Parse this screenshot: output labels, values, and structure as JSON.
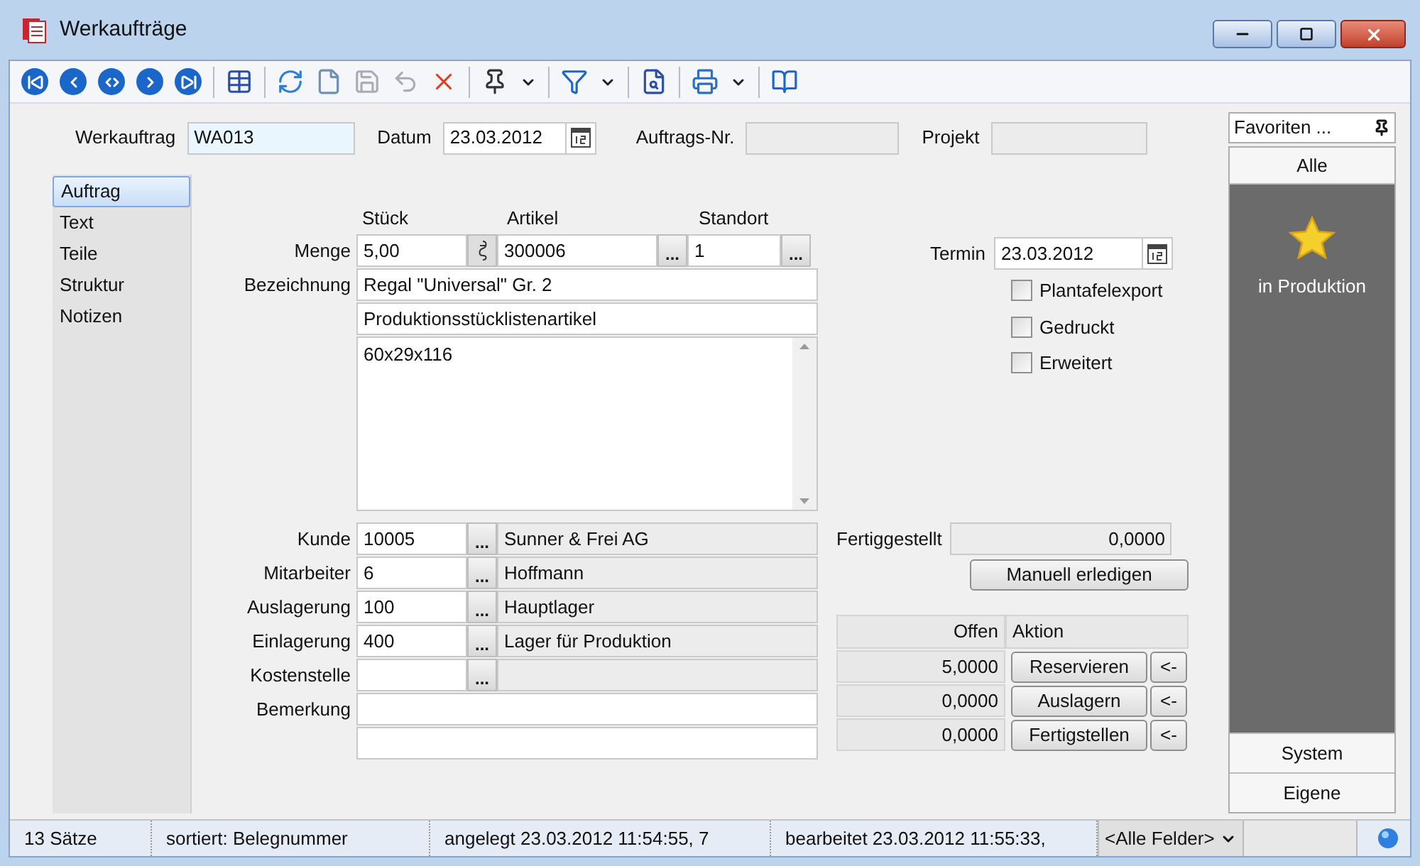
{
  "window": {
    "title": "Werkaufträge"
  },
  "toolbar": [
    {
      "kind": "first",
      "disabled": false
    },
    {
      "kind": "prev",
      "disabled": false
    },
    {
      "kind": "goto",
      "disabled": false
    },
    {
      "kind": "next",
      "disabled": false
    },
    {
      "kind": "last",
      "disabled": false
    },
    {
      "kind": "sep"
    },
    {
      "kind": "table",
      "disabled": false
    },
    {
      "kind": "sep"
    },
    {
      "kind": "refresh",
      "disabled": false
    },
    {
      "kind": "new",
      "disabled": false
    },
    {
      "kind": "save",
      "disabled": true
    },
    {
      "kind": "undo",
      "disabled": true
    },
    {
      "kind": "delete",
      "disabled": false
    },
    {
      "kind": "sep"
    },
    {
      "kind": "pin",
      "disabled": false
    },
    {
      "kind": "caret",
      "disabled": false
    },
    {
      "kind": "sep"
    },
    {
      "kind": "filter",
      "disabled": false
    },
    {
      "kind": "caret",
      "disabled": false
    },
    {
      "kind": "sep"
    },
    {
      "kind": "doc",
      "disabled": false
    },
    {
      "kind": "sep"
    },
    {
      "kind": "print",
      "disabled": false
    },
    {
      "kind": "caret",
      "disabled": false
    },
    {
      "kind": "sep"
    },
    {
      "kind": "book",
      "disabled": false
    }
  ],
  "header": {
    "werkauftrag": {
      "label": "Werkauftrag",
      "value": "WA013"
    },
    "datum": {
      "label": "Datum",
      "value": "23.03.2012"
    },
    "auftrags_nr": {
      "label": "Auftrags-Nr."
    },
    "projekt": {
      "label": "Projekt"
    }
  },
  "nav": [
    {
      "label": "Auftrag",
      "selected": true
    },
    {
      "label": "Text",
      "selected": false
    },
    {
      "label": "Teile",
      "selected": false
    },
    {
      "label": "Struktur",
      "selected": false
    },
    {
      "label": "Notizen",
      "selected": false
    }
  ],
  "form": {
    "column_heads": [
      "Stück",
      "Artikel",
      "Standort"
    ],
    "menge": {
      "label": "Menge",
      "stueck": "5,00",
      "artikel": "300006",
      "artikel_button": "...",
      "standort": "1",
      "standort_button": "..."
    },
    "bezeichnung": {
      "label": "Bezeichnung",
      "line_1": "Regal \"Universal\" Gr. 2",
      "line_2": "Produktionsstücklistenartikel",
      "memo": "60x29x116"
    },
    "lookups": [
      {
        "label": "Kunde",
        "code": "10005",
        "button": "...",
        "name": "Sunner & Frei AG"
      },
      {
        "label": "Mitarbeiter",
        "code": "6",
        "button": "...",
        "name": "Hoffmann"
      },
      {
        "label": "Auslagerung",
        "code": "100",
        "button": "...",
        "name": "Hauptlager"
      },
      {
        "label": "Einlagerung",
        "code": "400",
        "button": "...",
        "name": "Lager für Produktion"
      },
      {
        "label": "Kostenstelle",
        "button": "..."
      }
    ],
    "bemerkung": {
      "label": "Bemerkung"
    }
  },
  "side": {
    "termin": {
      "label": "Termin",
      "value": "23.03.2012"
    },
    "checkboxes": [
      {
        "label": "Plantafelexport",
        "checked": false
      },
      {
        "label": "Gedruckt",
        "checked": false
      },
      {
        "label": "Erweitert",
        "checked": false
      }
    ],
    "fertiggestellt": {
      "label": "Fertiggestellt",
      "value": "0,0000"
    },
    "manual_button": "Manuell erledigen",
    "actions": {
      "columns": [
        "Offen",
        "Aktion"
      ],
      "rows": [
        {
          "offen": "5,0000",
          "action": "Reservieren",
          "arrow": "<-"
        },
        {
          "offen": "0,0000",
          "action": "Auslagern",
          "arrow": "<-"
        },
        {
          "offen": "0,0000",
          "action": "Fertigstellen",
          "arrow": "<-"
        }
      ]
    }
  },
  "favorites": {
    "title": "Favoriten ...",
    "top_tab": "Alle",
    "items": [
      "in Produktion"
    ],
    "bottom_tabs": [
      "System",
      "Eigene"
    ]
  },
  "status_bar": {
    "segments": [
      "13 Sätze",
      "sortiert: Belegnummer",
      "angelegt 23.03.2012 11:54:55,  7",
      "bearbeitet 23.03.2012 11:55:33,"
    ],
    "field_select": "<Alle Felder>"
  }
}
